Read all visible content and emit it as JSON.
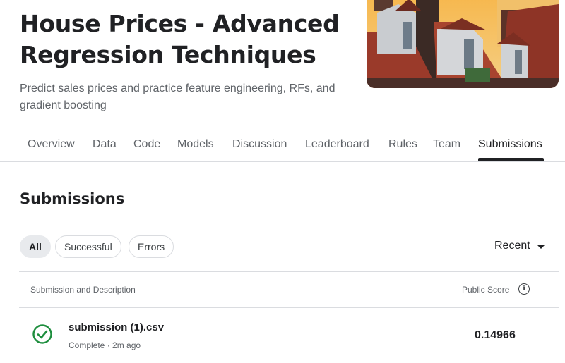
{
  "header": {
    "title": "House Prices - Advanced Regression Techniques",
    "subtitle": "Predict sales prices and practice feature engineering, RFs, and gradient boosting"
  },
  "tabs": [
    {
      "label": "Overview"
    },
    {
      "label": "Data"
    },
    {
      "label": "Code"
    },
    {
      "label": "Models"
    },
    {
      "label": "Discussion"
    },
    {
      "label": "Leaderboard"
    },
    {
      "label": "Rules"
    },
    {
      "label": "Team"
    },
    {
      "label": "Submissions",
      "active": true
    }
  ],
  "submissions": {
    "title": "Submissions",
    "filters": [
      {
        "label": "All",
        "active": true
      },
      {
        "label": "Successful"
      },
      {
        "label": "Errors"
      }
    ],
    "sort": {
      "label": "Recent"
    },
    "columns": {
      "description": "Submission and Description",
      "score": "Public Score"
    },
    "rows": [
      {
        "file": "submission (1).csv",
        "status": "Complete · 2m ago",
        "score": "0.14966",
        "status_icon": "check-circle-icon",
        "status_color": "#1e8e3e"
      }
    ]
  }
}
